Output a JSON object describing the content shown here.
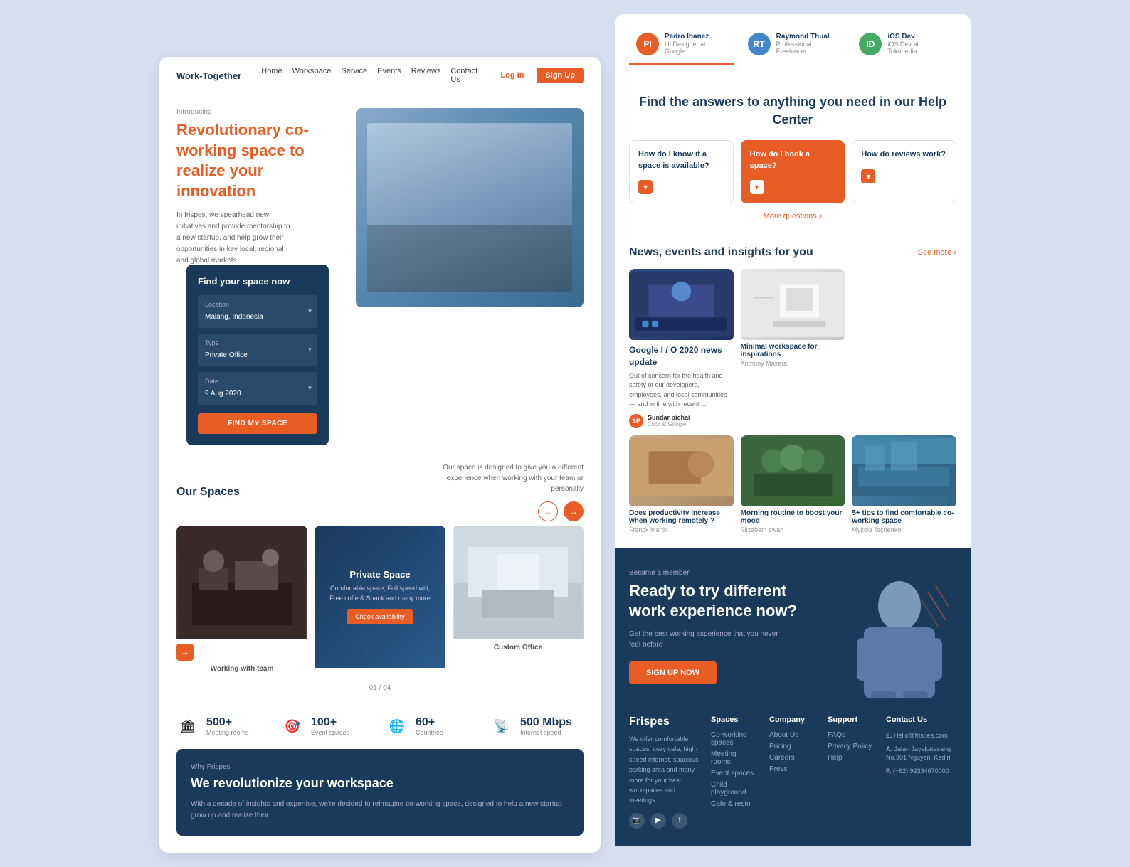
{
  "brand": {
    "logo": "Work-Together",
    "footer_brand": "Frispes"
  },
  "nav": {
    "links": [
      "Home",
      "Workspace",
      "Service",
      "Events",
      "Reviews",
      "Contact Us"
    ],
    "login": "Log In",
    "signup": "Sign Up"
  },
  "hero": {
    "introducing": "Introducing",
    "title_orange": "Revolutionary",
    "title_rest": " co-working space to realize your innovation",
    "description": "In frispes, we spearhead new initiatives and provide mentorship to a new startup, and help grow their opportunities in key local, regional and global markets"
  },
  "find_space": {
    "title": "Find your space now",
    "location_label": "Location",
    "location_value": "Malang, Indonesia",
    "type_label": "Type",
    "type_value": "Private Office",
    "date_label": "Date",
    "date_value": "9 Aug 2020",
    "button": "FIND MY SPACE"
  },
  "our_spaces": {
    "title": "Our Spaces",
    "description": "Our space is designed to give you a different experience when working with your team or personally",
    "cards": [
      {
        "label": "Working with team",
        "type": "dark-office"
      },
      {
        "title": "Private Space",
        "description": "Comfortable space, Full speed wifi, Free coffe & Snack and many more",
        "type": "navy",
        "button": "Check availability"
      },
      {
        "label": "Custom Office",
        "type": "white-office"
      }
    ],
    "pagination": "01 / 04"
  },
  "stats": [
    {
      "number": "500+",
      "label": "Meeting rooms",
      "icon": "🏛"
    },
    {
      "number": "100+",
      "label": "Event spaces",
      "icon": "🎯"
    },
    {
      "number": "60+",
      "label": "Countries",
      "icon": "🌐"
    },
    {
      "number": "500 Mbps",
      "label": "Internet speed",
      "icon": "📡"
    }
  ],
  "why": {
    "label": "Why Frispes",
    "title": "We revolutionize your workspace",
    "description": "With a decade of insights and expertise, we're decided to reimagine co-working space, designed to help a new startup grow up and realize their"
  },
  "testimonials": [
    {
      "name": "Pedro Ibanez",
      "role": "UI Designer at Google",
      "color": "#e85d26",
      "initials": "PI"
    },
    {
      "name": "Raymond Thual",
      "role": "Professional Freelancer",
      "color": "#4488cc",
      "initials": "RT"
    },
    {
      "name": "iOS Dev",
      "role": "iOS Dev at Tokopedia",
      "color": "#44aa66",
      "initials": "ID"
    }
  ],
  "help": {
    "title": "Find the answers to anything you need in our Help Center",
    "faqs": [
      {
        "question": "How do I know if a space is available?",
        "highlighted": false
      },
      {
        "question": "How do I book a space?",
        "highlighted": true
      },
      {
        "question": "How do reviews work?",
        "highlighted": false
      }
    ],
    "more_questions": "More questions"
  },
  "news": {
    "title": "News, events and insights for you",
    "see_more": "See more",
    "articles": [
      {
        "title": "Google I / O 2020 news update",
        "excerpt": "Out of concern for the health and safety of our developers, employees, and local communities — and in line with recent ...",
        "author_name": "Sundar pichai",
        "author_role": "CEO at Google",
        "img_type": "conference"
      },
      {
        "title": "Minimal workspace for inspirations",
        "author": "Anthony Maseral",
        "img_type": "office-minimal"
      },
      {
        "title": "Does productivity increase when working remotely ?",
        "author": "Franck Martin",
        "img_type": "typing"
      },
      {
        "title": "Morning routine to boost your mood",
        "author": "Elizabeth swan",
        "img_type": "team"
      },
      {
        "title": "5+ tips to find comfortable co-working space",
        "author": "Mykola Tschenko",
        "img_type": "cowork"
      }
    ]
  },
  "cta": {
    "label": "Became a member",
    "title": "Ready to try different work experience now?",
    "description": "Get the best working experience that you never feel before",
    "button": "SIGN UP NOW"
  },
  "footer": {
    "brand_desc": "We offer comfortable spaces, cozy cafe, high-speed internet, spacious parking area and many more for your best workspaces and meetings",
    "spaces": {
      "title": "Spaces",
      "links": [
        "Co-working spaces",
        "Meeting rooms",
        "Event spaces",
        "Child playground",
        "Cafe & resto"
      ]
    },
    "company": {
      "title": "Company",
      "links": [
        "About Us",
        "Pricing",
        "Careers",
        "Press"
      ]
    },
    "support": {
      "title": "Support",
      "links": [
        "FAQs",
        "Privacy Policy",
        "Help"
      ]
    },
    "contact": {
      "title": "Contact Us",
      "email_label": "E.",
      "email": "Hello@frispes.com",
      "address_label": "A.",
      "address": "Jalan Jayakatasang No.301 Nguyen, Kediri",
      "phone_label": "P.",
      "phone": "(+62) 92334670000"
    }
  }
}
